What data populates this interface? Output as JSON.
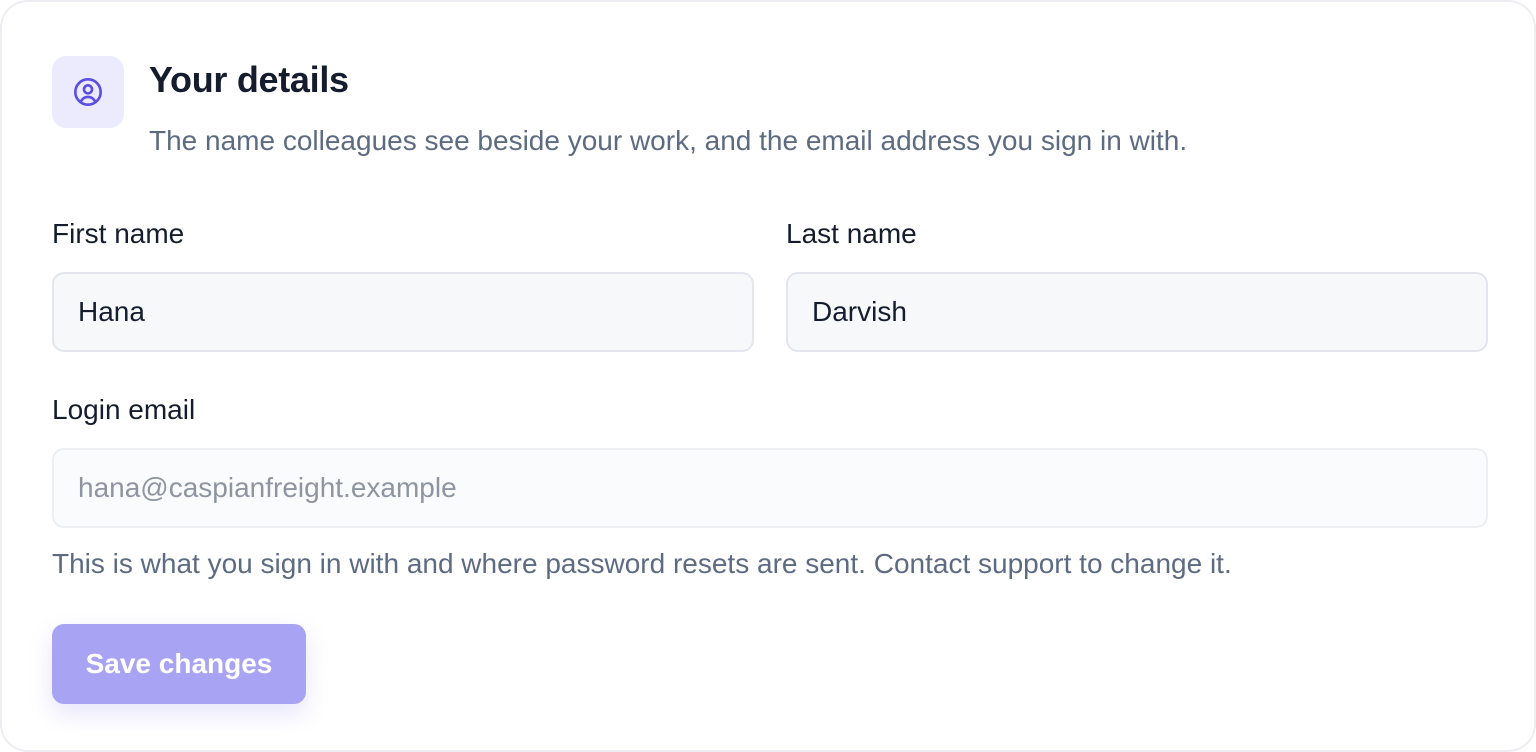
{
  "section": {
    "icon": "user-circle-icon",
    "title": "Your details",
    "subtitle": "The name colleagues see beside your work, and the email address you sign in with."
  },
  "form": {
    "first_name": {
      "label": "First name",
      "value": "Hana"
    },
    "last_name": {
      "label": "Last name",
      "value": "Darvish"
    },
    "login_email": {
      "label": "Login email",
      "value": "hana@caspianfreight.example",
      "disabled": true,
      "help": "This is what you sign in with and where password resets are sent. Contact support to change it."
    },
    "save_label": "Save changes",
    "save_enabled": false
  },
  "colors": {
    "accent": "#6c5ce7",
    "accent_soft": "#ecebfd",
    "button_disabled": "#a8a3f2",
    "text_primary": "#141c2e",
    "text_secondary": "#5d6b82"
  }
}
